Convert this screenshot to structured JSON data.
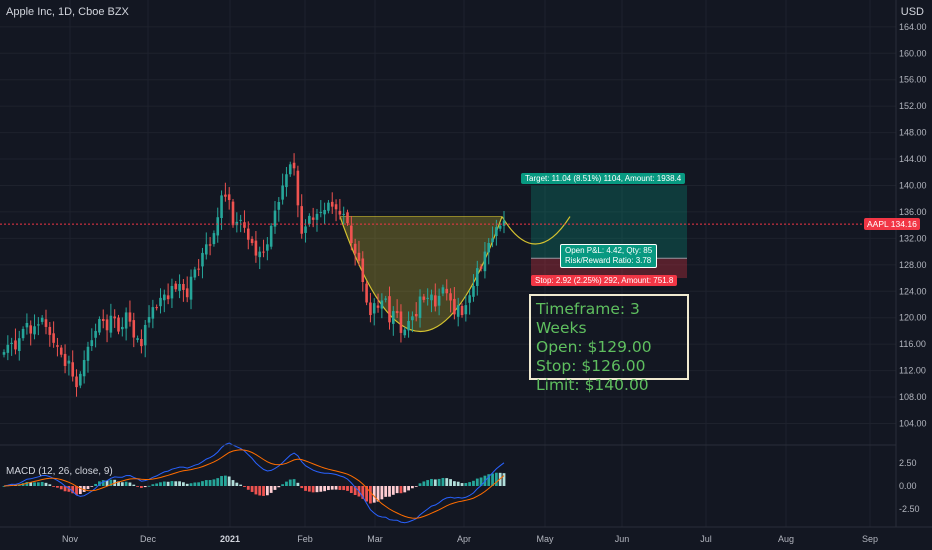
{
  "header": {
    "title": "Apple Inc, 1D, Cboe BZX",
    "currency": "USD"
  },
  "symbol_tag": {
    "symbol": "AAPL",
    "price": "134.16"
  },
  "position": {
    "target_label": "Target: 11.04 (8.51%) 1104, Amount: 1938.4",
    "stop_label": "Stop: 2.92 (2.25%) 292, Amount: 751.8",
    "pnl_line1": "Open P&L: 4.42, Qty: 85",
    "pnl_line2": "Risk/Reward Ratio: 3.78"
  },
  "info_box": {
    "timeframe": "Timeframe: 3 Weeks",
    "open": "Open: $129.00",
    "stop": "Stop: $126.00",
    "limit": "Limit: $140.00"
  },
  "macd_label": "MACD (12, 26, close, 9)",
  "colors": {
    "background": "#131722",
    "up": "#26a69a",
    "down": "#ef5350",
    "macd_line": "#2962ff",
    "signal_line": "#ff6d00",
    "pattern": "#d4c230",
    "target_zone": "#089981",
    "stop_zone": "#f23645"
  },
  "chart_data": [
    {
      "type": "candlestick",
      "title": "Apple Inc, 1D, Cboe BZX",
      "x_ticks": [
        "Nov",
        "Dec",
        "2021",
        "Feb",
        "Mar",
        "Apr",
        "May",
        "Jun",
        "Jul",
        "Aug",
        "Sep"
      ],
      "y_ticks": [
        104,
        108,
        112,
        116,
        120,
        124,
        128,
        132,
        136,
        140,
        144,
        148,
        152,
        156,
        160,
        164
      ],
      "ylim": [
        101.5,
        167
      ],
      "last_price": 134.16,
      "position": {
        "entry": 129.0,
        "stop": 126.0,
        "target": 140.0
      },
      "closes": [
        114.8,
        115.9,
        116.2,
        115.2,
        116.9,
        118.3,
        119.2,
        117.6,
        118.7,
        119.0,
        120.0,
        118.6,
        117.4,
        116.2,
        115.6,
        114.4,
        112.7,
        113.5,
        111.1,
        109.5,
        111.5,
        113.6,
        115.6,
        116.6,
        118.0,
        119.8,
        119.5,
        118.1,
        120.3,
        119.9,
        117.9,
        118.6,
        120.8,
        119.4,
        117.0,
        116.9,
        115.7,
        118.9,
        120.1,
        121.6,
        121.5,
        123.0,
        123.5,
        122.8,
        124.8,
        124.3,
        125.1,
        124.2,
        123.1,
        126.2,
        127.3,
        127.4,
        129.8,
        131.1,
        130.9,
        132.8,
        135.2,
        138.5,
        138.3,
        137.8,
        134.0,
        134.5,
        134.8,
        133.6,
        131.8,
        131.3,
        129.4,
        130.0,
        129.9,
        131.1,
        133.9,
        136.2,
        137.5,
        140.0,
        141.7,
        143.2,
        142.6,
        137.0,
        132.7,
        133.8,
        135.4,
        134.8,
        135.7,
        136.0,
        136.3,
        137.4,
        136.8,
        136.4,
        135.6,
        135.7,
        134.3,
        131.3,
        129.7,
        128.6,
        125.4,
        122.3,
        120.4,
        122.2,
        121.5,
        122.6,
        122.9,
        119.3,
        121.0,
        120.7,
        117.7,
        118.2,
        119.5,
        120.2,
        120.2,
        123.2,
        122.7,
        123.0,
        123.5,
        121.7,
        123.3,
        124.6,
        123.7,
        122.6,
        120.5,
        121.9,
        120.4,
        121.9,
        123.4,
        124.8,
        127.5,
        127.4,
        130.0,
        131.3,
        132.0,
        133.7,
        133.9,
        134.7
      ],
      "macd": {
        "ylim": [
          -4.2,
          4.2
        ],
        "y_ticks": [
          2.5,
          0.0,
          -2.5
        ]
      }
    }
  ]
}
